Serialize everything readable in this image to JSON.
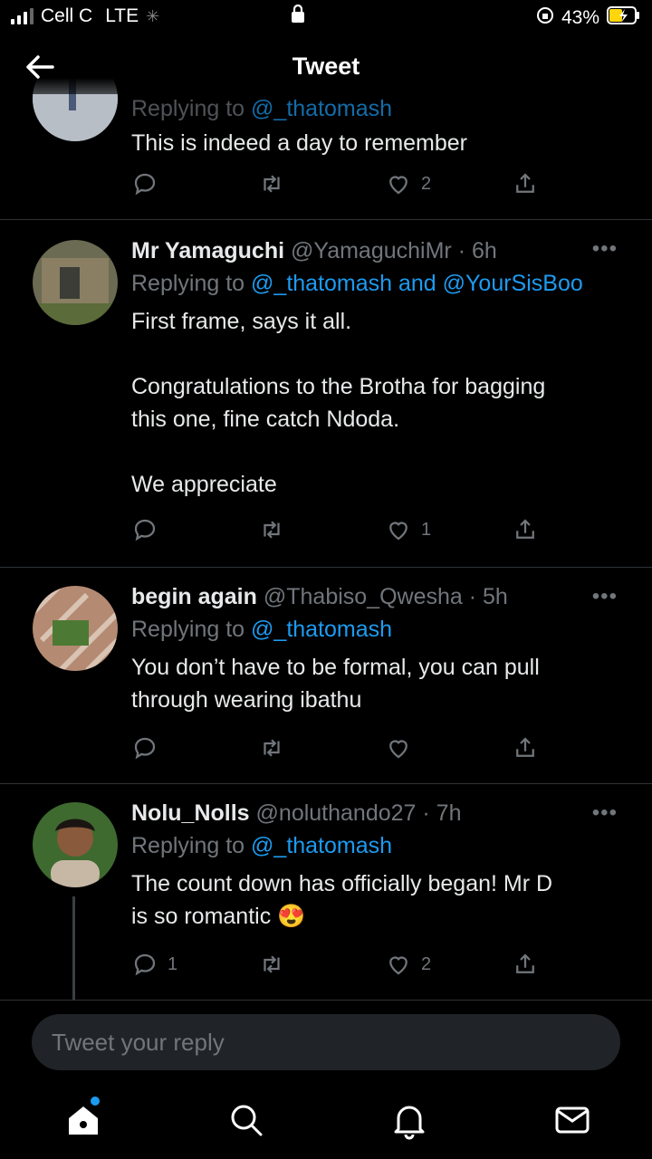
{
  "status_bar": {
    "carrier": "Cell C",
    "network": "LTE",
    "battery": "43%"
  },
  "header": {
    "title": "Tweet"
  },
  "tweets": [
    {
      "name": "",
      "handle": "",
      "time": "",
      "reply_prefix": "Replying to",
      "reply_mentions": "@_thatomash",
      "text": "This is indeed a day to remember",
      "replies": "",
      "likes": "2"
    },
    {
      "name": "Mr Yamaguchi",
      "handle": "@YamaguchiMr",
      "time": "6h",
      "reply_prefix": "Replying to",
      "reply_mentions": "@_thatomash and @YourSisBoo",
      "text": "First frame, says it all.\n\nCongratulations to the Brotha for bagging\nthis one, fine catch Ndoda.\n\nWe appreciate",
      "replies": "",
      "likes": "1"
    },
    {
      "name": "begin again",
      "handle": "@Thabiso_Qwesha",
      "time": "5h",
      "reply_prefix": "Replying to",
      "reply_mentions": "@_thatomash",
      "text": "You don’t have to be formal, you can pull\nthrough wearing ibathu",
      "replies": "",
      "likes": ""
    },
    {
      "name": "Nolu_Nolls",
      "handle": "@noluthando27",
      "time": "7h",
      "reply_prefix": "Replying to",
      "reply_mentions": "@_thatomash",
      "text": "The count down has officially began! Mr D\nis so romantic",
      "emoji": "😍",
      "replies": "1",
      "likes": "2"
    }
  ],
  "composer": {
    "placeholder": "Tweet your reply"
  },
  "nav": [
    "home-icon",
    "search-icon",
    "notifications-icon",
    "messages-icon"
  ],
  "colors": {
    "accent": "#1d9bf0",
    "background": "#000000",
    "muted": "#71767b",
    "divider": "#2f3336"
  }
}
